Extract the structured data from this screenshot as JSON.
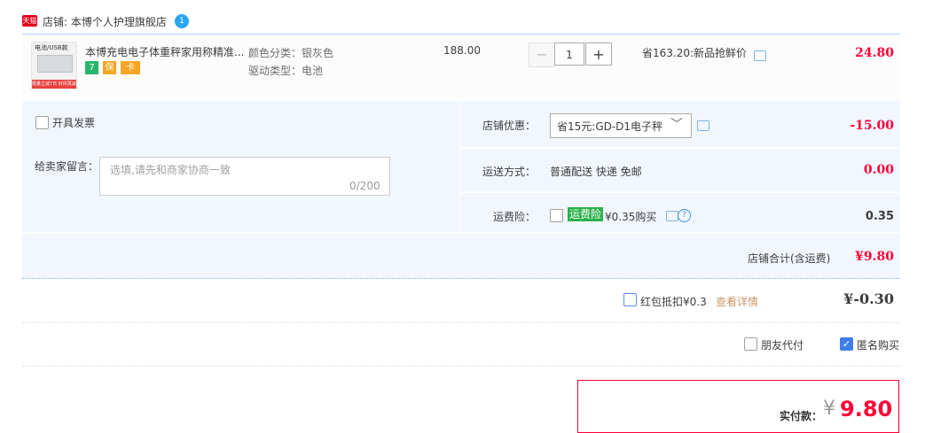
{
  "shop": {
    "badge": "天猫",
    "label": "店铺: 本博个人护理旗舰店",
    "ww_icon": "1"
  },
  "item": {
    "thumb_top": "电池/USB款",
    "thumb_bottom": "限量立减7日 好评再减¥5",
    "title": "本博充电电子体重秤家用称精准...",
    "services": [
      "7",
      "保",
      "卡"
    ],
    "sku_color": "颜色分类：银灰色",
    "sku_drive": "驱动类型：电池",
    "price": "188.00",
    "qty_minus": "−",
    "qty": "1",
    "qty_plus": "+",
    "promo": "省163.20:新品抢鲜价",
    "total": "24.80"
  },
  "options": {
    "invoice_label": "开具发票",
    "message_label": "给卖家留言：",
    "message_placeholder": "选填,请先和商家协商一致",
    "message_count": "0/200",
    "shop_discount_label": "店铺优惠：",
    "shop_discount_value": "省15元:GD-D1电子秤",
    "shop_discount_chevron": "﹀",
    "shop_discount_amount": "-15.00",
    "shipping_label": "运送方式：",
    "shipping_value": "普通配送 快递 免邮",
    "shipping_amount": "0.00",
    "insurance_label": "运费险：",
    "insurance_tag": "运费险",
    "insurance_text": "¥0.35购买",
    "insurance_help": "?",
    "insurance_amount": "0.35",
    "subtotal_label": "店铺合计(含运费)",
    "subtotal_value": "¥9.80"
  },
  "redpacket": {
    "label": "红包抵扣¥0.3",
    "link": "查看详情",
    "amount": "¥-0.30"
  },
  "friend_pay": "朋友代付",
  "anonymous": {
    "label": "匿名购买",
    "check": "✓"
  },
  "payment": {
    "label": "实付款：",
    "currency": "¥",
    "amount": "9.80"
  },
  "colors": {
    "red": "#ff0036",
    "blue_border": "#b2d1ff",
    "panel_bg": "#f2f7ff",
    "insurance_green": "#2bb14b"
  }
}
